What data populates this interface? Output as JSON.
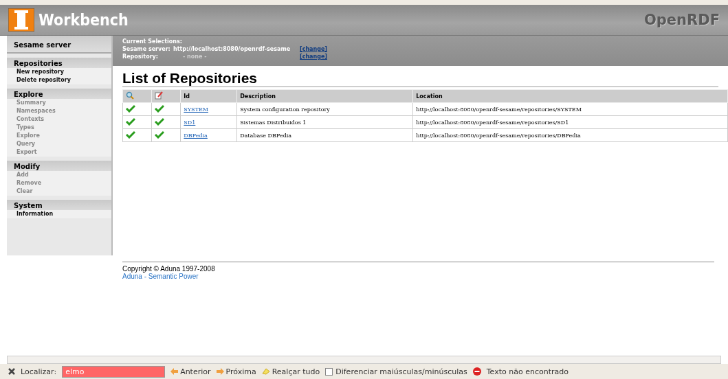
{
  "header": {
    "title": "Workbench",
    "brand": "OpenRDF"
  },
  "selections": {
    "heading": "Current Selections:",
    "rows": [
      {
        "label": "Sesame server:",
        "value": "http://localhost:8080/openrdf-sesame",
        "muted": false,
        "link": "[change]"
      },
      {
        "label": "Repository:",
        "value": "- none -",
        "muted": true,
        "link": "[change]"
      }
    ]
  },
  "sidebar": {
    "title": "Sesame server",
    "sections": [
      {
        "heading": "Repositories",
        "items": [
          {
            "label": "New repository",
            "disabled": false
          },
          {
            "label": "Delete repository",
            "disabled": false
          }
        ]
      },
      {
        "heading": "Explore",
        "items": [
          {
            "label": "Summary",
            "disabled": true
          },
          {
            "label": "Namespaces",
            "disabled": true
          },
          {
            "label": "Contexts",
            "disabled": true
          },
          {
            "label": "Types",
            "disabled": true
          },
          {
            "label": "Explore",
            "disabled": true
          },
          {
            "label": "Query",
            "disabled": true
          },
          {
            "label": "Export",
            "disabled": true
          }
        ]
      },
      {
        "heading": "Modify",
        "items": [
          {
            "label": "Add",
            "disabled": true
          },
          {
            "label": "Remove",
            "disabled": true
          },
          {
            "label": "Clear",
            "disabled": true
          }
        ]
      },
      {
        "heading": "System",
        "items": [
          {
            "label": "Information",
            "disabled": false
          }
        ]
      }
    ]
  },
  "page_title": "List of Repositories",
  "table": {
    "columns": [
      "Id",
      "Description",
      "Location"
    ],
    "rows": [
      {
        "readable": true,
        "writable": true,
        "id": "SYSTEM",
        "description": "System configuration repository",
        "location": "http://localhost:8080/openrdf-sesame/repositories/SYSTEM"
      },
      {
        "readable": true,
        "writable": true,
        "id": "SD1",
        "description": "Sistemas Distribuidos 1",
        "location": "http://localhost:8080/openrdf-sesame/repositories/SD1"
      },
      {
        "readable": true,
        "writable": true,
        "id": "DBPedia",
        "description": "Database DBPedia",
        "location": "http://localhost:8080/openrdf-sesame/repositories/DBPedia"
      }
    ]
  },
  "footer": {
    "copyright": "Copyright © Aduna 1997-2008",
    "link": "Aduna - Semantic Power"
  },
  "find_bar": {
    "label": "Localizar:",
    "value": "elmo",
    "not_found": true,
    "previous": "Anterior",
    "next": "Próxima",
    "highlight": "Realçar tudo",
    "match_case": {
      "label": "Diferenciar maiúsculas/minúsculas",
      "checked": false
    },
    "status": "Texto não encontrado"
  }
}
